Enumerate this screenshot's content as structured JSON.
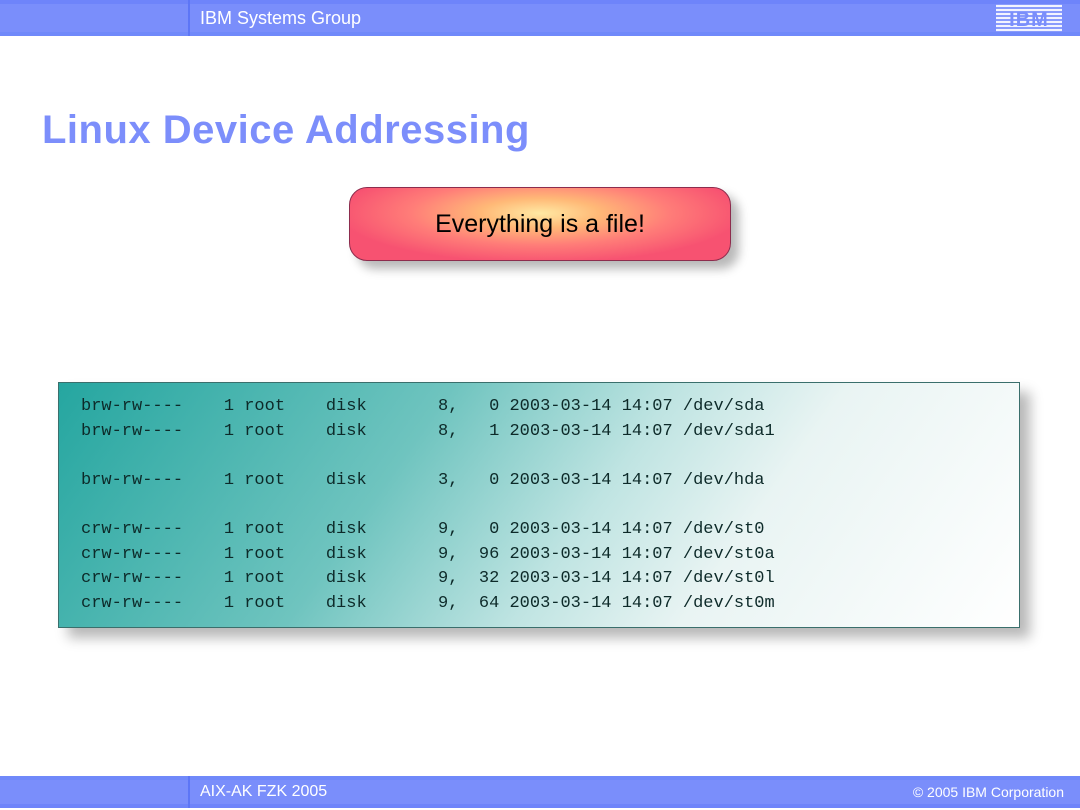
{
  "header": {
    "group": "IBM Systems Group",
    "logo_text": "IBM"
  },
  "title": "Linux Device Addressing",
  "callout": "Everything is a file!",
  "listing": [
    {
      "perms": "brw-rw----",
      "links": "1",
      "owner": "root",
      "group": "disk",
      "major": "8,",
      "minor": "0",
      "date": "2003-03-14 14:07",
      "path": "/dev/sda"
    },
    {
      "perms": "brw-rw----",
      "links": "1",
      "owner": "root",
      "group": "disk",
      "major": "8,",
      "minor": "1",
      "date": "2003-03-14 14:07",
      "path": "/dev/sda1"
    },
    null,
    {
      "perms": "brw-rw----",
      "links": "1",
      "owner": "root",
      "group": "disk",
      "major": "3,",
      "minor": "0",
      "date": "2003-03-14 14:07",
      "path": "/dev/hda"
    },
    null,
    {
      "perms": "crw-rw----",
      "links": "1",
      "owner": "root",
      "group": "disk",
      "major": "9,",
      "minor": "0",
      "date": "2003-03-14 14:07",
      "path": "/dev/st0"
    },
    {
      "perms": "crw-rw----",
      "links": "1",
      "owner": "root",
      "group": "disk",
      "major": "9,",
      "minor": "96",
      "date": "2003-03-14 14:07",
      "path": "/dev/st0a"
    },
    {
      "perms": "crw-rw----",
      "links": "1",
      "owner": "root",
      "group": "disk",
      "major": "9,",
      "minor": "32",
      "date": "2003-03-14 14:07",
      "path": "/dev/st0l"
    },
    {
      "perms": "crw-rw----",
      "links": "1",
      "owner": "root",
      "group": "disk",
      "major": "9,",
      "minor": "64",
      "date": "2003-03-14 14:07",
      "path": "/dev/st0m"
    }
  ],
  "footer": {
    "left": "AIX-AK FZK 2005",
    "right": "© 2005 IBM Corporation"
  }
}
